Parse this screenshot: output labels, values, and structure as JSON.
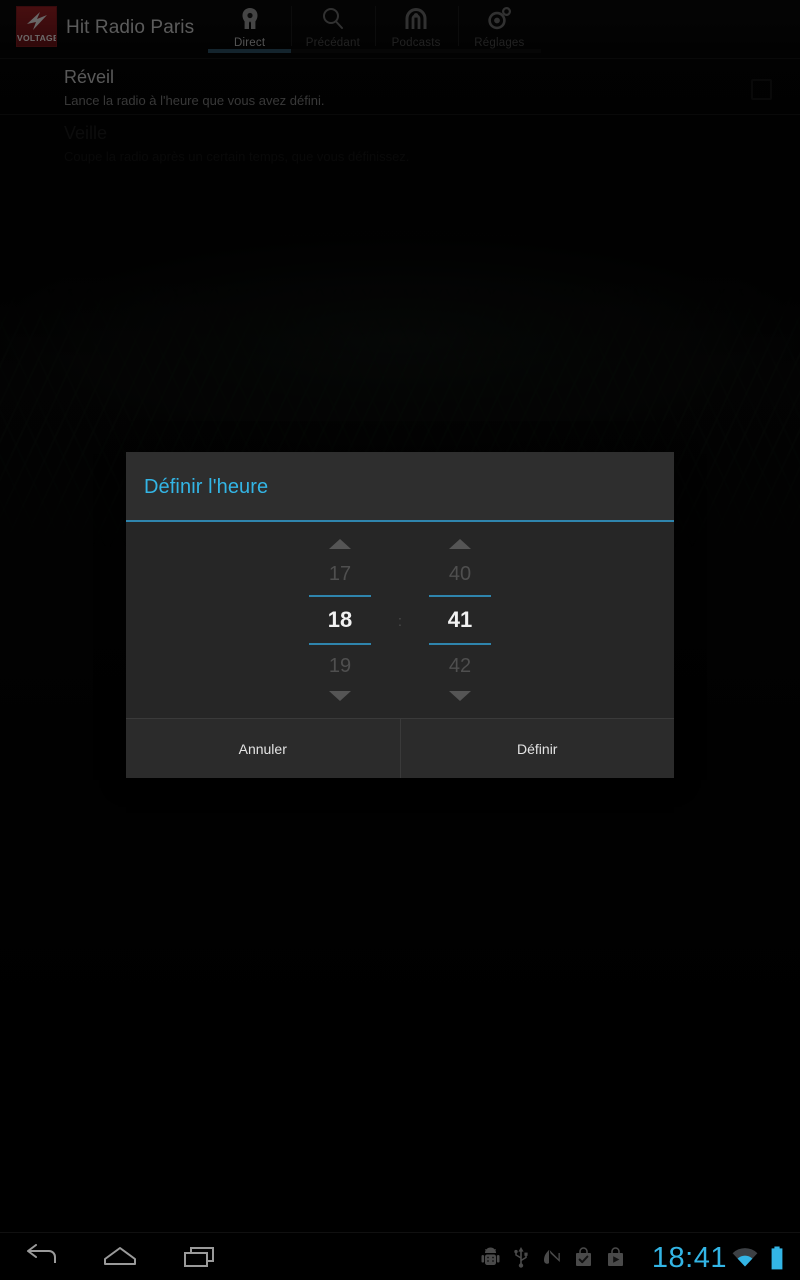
{
  "app": {
    "title": "Hit Radio Paris",
    "logo_wordmark": "VOLTAGE",
    "logo_icon": "lightning-bolt-icon"
  },
  "tabs": [
    {
      "label": "Direct",
      "icon": "head-profile-icon",
      "selected": true
    },
    {
      "label": "Précédant",
      "icon": "search-icon",
      "selected": false
    },
    {
      "label": "Podcasts",
      "icon": "podcast-arch-icon",
      "selected": false
    },
    {
      "label": "Réglages",
      "icon": "gear-icon",
      "selected": false
    }
  ],
  "settings": {
    "rows": [
      {
        "title": "Réveil",
        "summary": "Lance la radio à l'heure que vous avez défini.",
        "disabled": false,
        "checkbox": {
          "checked": false
        }
      },
      {
        "title": "Veille",
        "summary": "Coupe la radio après un certain temps, que vous définissez.",
        "disabled": true
      }
    ]
  },
  "dialog": {
    "title": "Définir l'heure",
    "time_separator": ":",
    "hour": {
      "previous": "17",
      "current": "18",
      "next": "19"
    },
    "minute": {
      "previous": "40",
      "current": "41",
      "next": "42"
    },
    "buttons": {
      "cancel": "Annuler",
      "confirm": "Définir"
    }
  },
  "system_bar": {
    "nav": [
      {
        "name": "back",
        "icon": "back-arrow-icon"
      },
      {
        "name": "home",
        "icon": "home-icon"
      },
      {
        "name": "recents",
        "icon": "recent-apps-icon"
      }
    ],
    "status_icons": [
      "android-debug-icon",
      "usb-icon",
      "music-note-icon",
      "check-bag-icon",
      "play-bag-icon"
    ],
    "clock": "18:41",
    "wifi": "wifi-icon",
    "battery": "battery-full-icon"
  },
  "colors": {
    "holo_blue": "#33b5e5",
    "holo_blue_dark": "#2f85ad",
    "brand_red": "#8d1c20",
    "dialog_bg": "#262626",
    "dialog_titlebar": "#2e2e2e"
  }
}
